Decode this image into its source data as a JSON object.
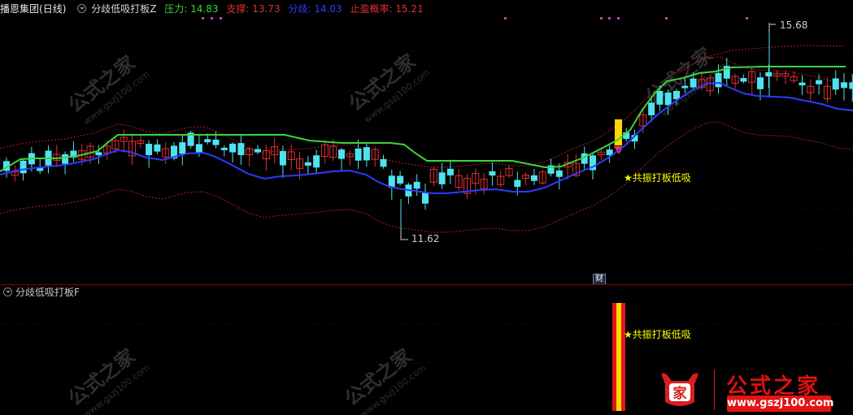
{
  "header": {
    "stock_name": "播恩集团",
    "period": "(日线)",
    "indicator_name": "分歧低吸打板Z",
    "items": [
      {
        "label": "压力:",
        "value": "14.83",
        "color": "#39d639"
      },
      {
        "label": "支撑:",
        "value": "13.73",
        "color": "#e03030"
      },
      {
        "label": "分歧:",
        "value": "14.03",
        "color": "#2d3bff"
      },
      {
        "label": "止盈概率:",
        "value": "15.21",
        "color": "#e03030"
      }
    ]
  },
  "main_chart": {
    "high_label": "15.68",
    "low_label": "11.62",
    "signal_text": "★共振打板低吸",
    "finance_badge": "财",
    "colors": {
      "up": "#e03030",
      "down": "#4fe3f0",
      "pressure": "#39d639",
      "divergence": "#2d3bff",
      "band": "#b02020",
      "signal_bar": "#ffd700",
      "annotation": "#ffff00",
      "dots": "#c040c0"
    }
  },
  "sub_chart": {
    "indicator_name": "分歧低吸打板F",
    "signal_text": "★共振打板低吸"
  },
  "watermark": {
    "text": "公式之家",
    "url": "www.gszj100.com"
  },
  "logo": {
    "text": "公式之家",
    "url": "www.gszj100.com",
    "badge_text": "家"
  }
}
